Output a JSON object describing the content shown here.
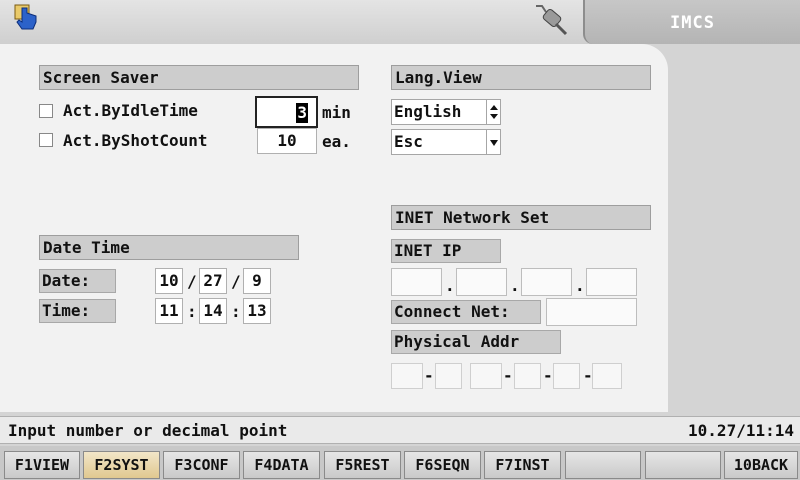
{
  "header": {
    "title": "IMCS",
    "left_icon": "hand-pointer-icon",
    "right_icon": "plug-icon"
  },
  "screen_saver": {
    "title": "Screen Saver",
    "idle_label": "Act.ByIdleTime",
    "idle_value": "3",
    "idle_unit": "min",
    "shot_label": "Act.ByShotCount",
    "shot_value": "10",
    "shot_unit": "ea."
  },
  "lang_view": {
    "title": "Lang.View",
    "language": "English",
    "esc_option": "Esc"
  },
  "date_time": {
    "title": "Date Time",
    "date_label": "Date:",
    "date_month": "10",
    "date_day": "27",
    "date_year": "9",
    "date_sep": "/",
    "time_label": "Time:",
    "time_hour": "11",
    "time_min": "14",
    "time_sec": "13",
    "time_sep": ":"
  },
  "inet": {
    "title": "INET Network Set",
    "ip_label": "INET IP",
    "ip_sep": ".",
    "connect_label": "Connect Net:",
    "phys_label": "Physical Addr",
    "mac_sep": "-"
  },
  "status": {
    "message": "Input number or decimal point",
    "datetime": "10.27/11:14"
  },
  "function_keys": [
    {
      "label": "F1VIEW"
    },
    {
      "label": "F2SYST"
    },
    {
      "label": "F3CONF"
    },
    {
      "label": "F4DATA"
    },
    {
      "label": "F5REST"
    },
    {
      "label": "F6SEQN"
    },
    {
      "label": "F7INST"
    },
    {
      "label": ""
    },
    {
      "label": ""
    },
    {
      "label": "10BACK"
    }
  ],
  "active_key": "F2SYST",
  "colors": {
    "panel": "#f2f2f2",
    "background": "#d4d4d4",
    "active_key": "#e0c890"
  }
}
